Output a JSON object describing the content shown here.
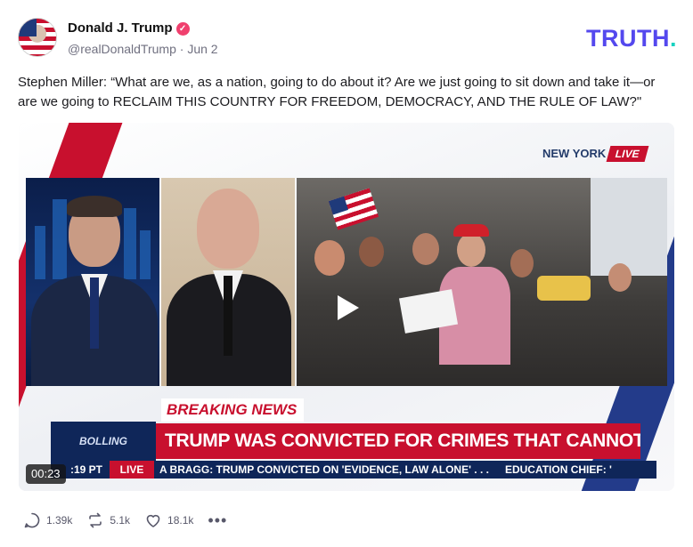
{
  "author": {
    "name": "Donald J. Trump",
    "handle": "@realDonaldTrump",
    "separator": "·",
    "date": "Jun 2",
    "verified_icon": "verified-badge-icon",
    "verified_color": "#f0406e"
  },
  "brand": {
    "logo_text": "TRUTH",
    "logo_dot": ".",
    "color": "#5448ee",
    "dot_color": "#17d2c0"
  },
  "post": {
    "text": "Stephen Miller: “What are we, as a nation, going to do about it? Are we just going to sit down and take it—or are we going to RECLAIM THIS COUNTRY FOR FREEDOM, DEMOCRACY, AND THE RULE OF LAW?\""
  },
  "video": {
    "duration": "00:23",
    "play_icon": "play-icon",
    "overlay": {
      "location": "NEW YORK",
      "live": "LIVE",
      "breaking_label": "BREAKING NEWS",
      "headline": "TRUMP WAS CONVICTED FOR CRIMES THAT CANNOT BE DEFINED",
      "show_logo": "BOLLING",
      "ticker_time": ":19 PT",
      "ticker_live": "LIVE",
      "ticker_text": "A BRAGG: TRUMP CONVICTED ON 'EVIDENCE, LAW ALONE' . . .",
      "ticker_text_2": "EDUCATION CHIEF: '"
    }
  },
  "actions": {
    "replies": "1.39k",
    "retruths": "5.1k",
    "likes": "18.1k",
    "more": "•••",
    "icons": [
      "reply-icon",
      "retruth-icon",
      "like-icon",
      "more-icon"
    ]
  }
}
